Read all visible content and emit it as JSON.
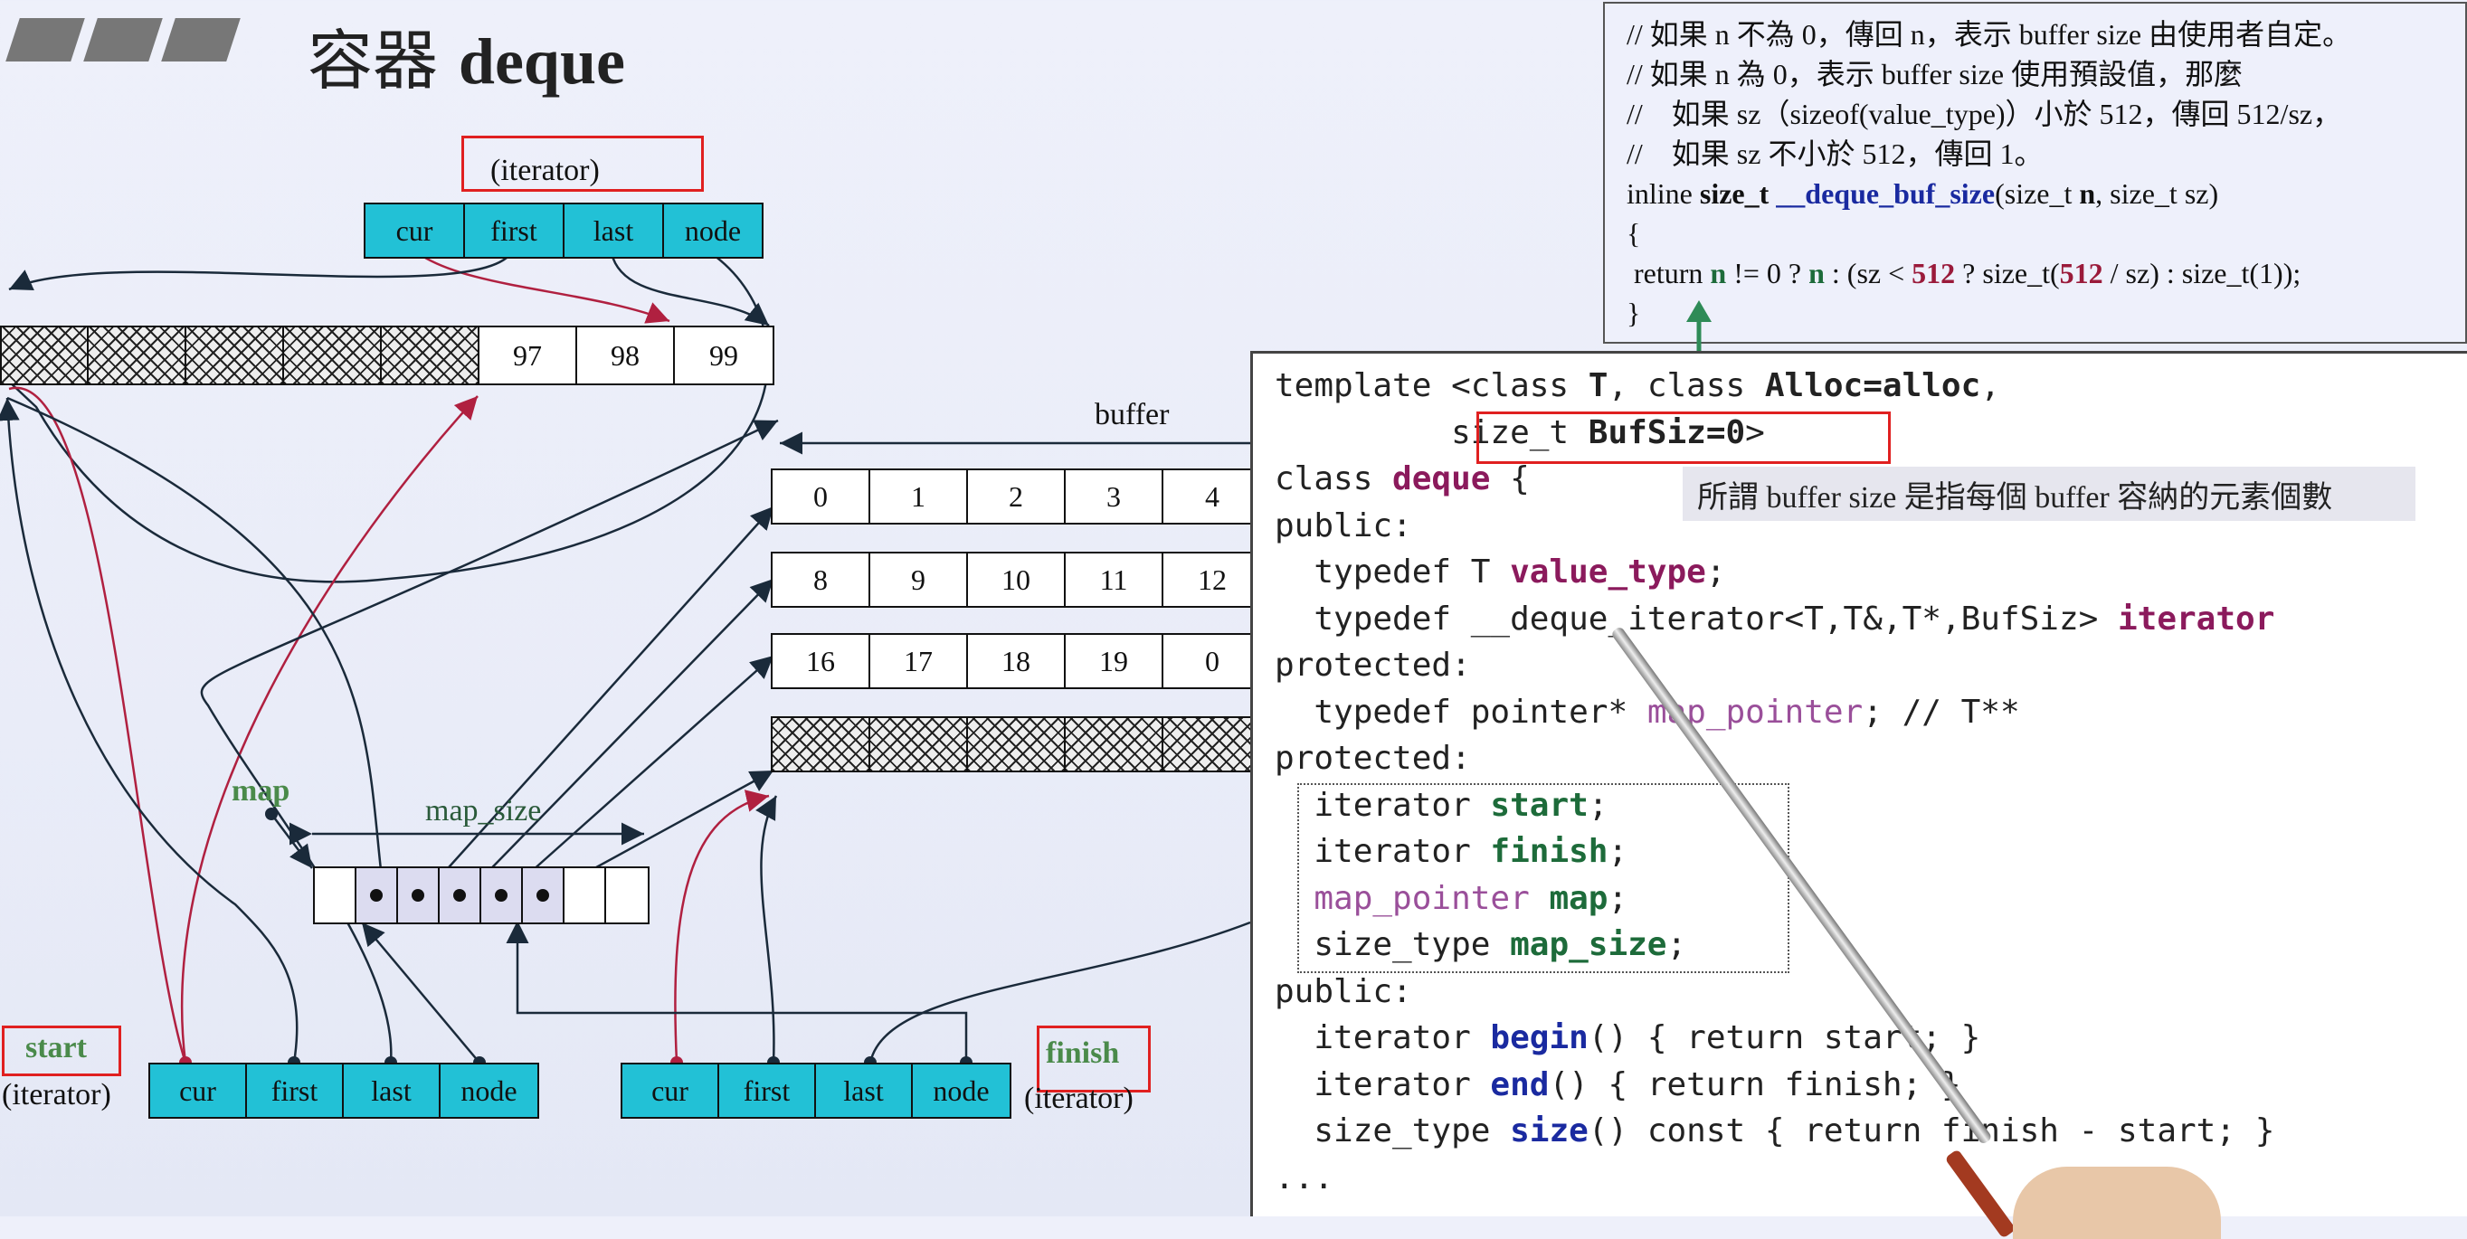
{
  "slide": {
    "title_cn": "容器",
    "title_en": "deque"
  },
  "diagram": {
    "iterator_label": "(iterator)",
    "iter_fields": [
      "cur",
      "first",
      "last",
      "node"
    ],
    "top_buffer_values": [
      "97",
      "98",
      "99"
    ],
    "buffer_label": "buffer",
    "buffer_rows": [
      [
        "0",
        "1",
        "2",
        "3",
        "4"
      ],
      [
        "8",
        "9",
        "10",
        "11",
        "12"
      ],
      [
        "16",
        "17",
        "18",
        "19",
        "0"
      ]
    ],
    "map_label": "map",
    "map_size_label": "map_size",
    "start_label": "start",
    "start_sub": "(iterator)",
    "finish_label": "finish",
    "finish_sub": "(iterator)"
  },
  "top_code": {
    "lines": [
      "// 如果 n 不為 0，傳回 n，表示 buffer size 由使用者自定。",
      "// 如果 n 為 0，表示 buffer size 使用預設值，那麼",
      "//    如果 sz（sizeof(value_type)）小於 512，傳回 512/sz，",
      "//    如果 sz 不小於 512，傳回 1。"
    ],
    "sig_prefix": "inline ",
    "sig_type": "size_t ",
    "sig_name": "__deque_buf_size",
    "sig_params_a": "(size_t ",
    "sig_param_n": "n",
    "sig_params_b": ", size_t sz)",
    "brace_open": "{",
    "ret_a": " return ",
    "ret_n1": "n",
    "ret_b": " != 0 ? ",
    "ret_n2": "n",
    "ret_c": " : (sz < ",
    "ret_512a": "512",
    "ret_d": " ? size_t(",
    "ret_512b": "512",
    "ret_e": " / sz) : size_t(1));",
    "brace_close": "}"
  },
  "main_code": {
    "l1a": "template <class ",
    "l1b": "T",
    "l1c": ", class ",
    "l1d": "Alloc=alloc",
    "l1e": ",",
    "l2a": "         size_t ",
    "l2b": "BufSiz=0",
    "l2c": ">",
    "l3a": "class ",
    "l3b": "deque",
    "l3c": " {",
    "l4": "public:",
    "l5a": "  typedef T ",
    "l5b": "value_type",
    "l5c": ";",
    "l6a": "  typedef __deque_iterator<T,T&,T*,BufSiz> ",
    "l6b": "iterator",
    "l7": "protected:",
    "l8a": "  typedef pointer* ",
    "l8b": "map_pointer",
    "l8c": "; // T**",
    "l9": "protected:",
    "l10a": "  iterator ",
    "l10b": "start",
    "l10c": ";",
    "l11a": "  iterator ",
    "l11b": "finish",
    "l11c": ";",
    "l12a": "  map_pointer ",
    "l12b": "map",
    "l12c": ";",
    "l13a": "  size_type ",
    "l13b": "map_size",
    "l13c": ";",
    "l14": "public:",
    "l15a": "  iterator ",
    "l15b": "begin",
    "l15c": "() { return start; }",
    "l16a": "  iterator ",
    "l16b": "end",
    "l16c": "() { return finish; }",
    "l17a": "  size_type ",
    "l17b": "size",
    "l17c": "() const { return finish - start; }",
    "l18": "..."
  },
  "annotation": "所謂 buffer size 是指每個 buffer 容納的元素個數",
  "colors": {
    "cyan_cell": "#22c1d6",
    "highlight_box": "#e02020",
    "label_green": "#4a8a4a",
    "arrow_green": "#2e8b57",
    "wire_red": "#b02040",
    "wire_dark": "#1a2a3a"
  }
}
